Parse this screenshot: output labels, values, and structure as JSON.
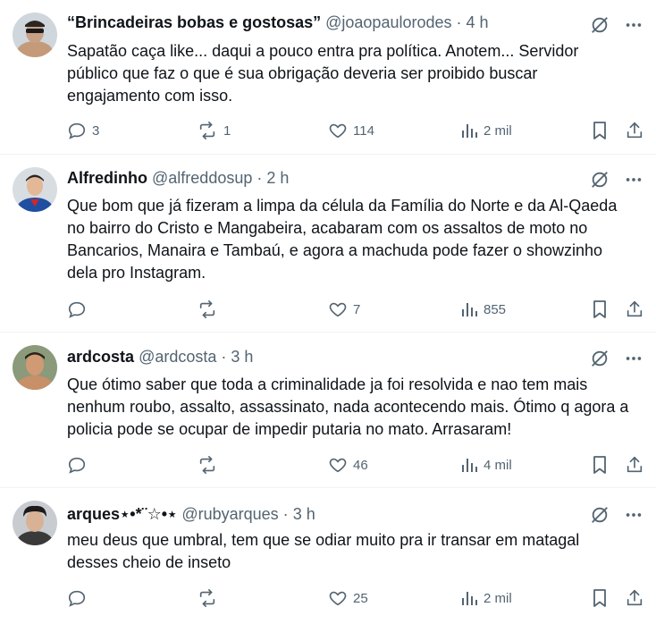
{
  "tweets": [
    {
      "name": "“Brincadeiras bobas e gostosas”",
      "handle": "@joaopaulorodes",
      "sep": "·",
      "time": "4 h",
      "text": [
        "Sapatão caça like... daqui a pouco entra pra política. Anotem... Servidor",
        "público que faz o que é sua obrigação deveria ser proibido buscar",
        "engajamento com isso."
      ],
      "replies": "3",
      "reposts": "1",
      "likes": "114",
      "views": "2 mil"
    },
    {
      "name": "Alfredinho",
      "handle": "@alfreddosup",
      "sep": "·",
      "time": "2 h",
      "text": [
        "Que bom que já fizeram a limpa da célula da Família do Norte e da Al-Qaeda",
        "no bairro do Cristo e Mangabeira, acabaram com os assaltos de moto no",
        "Bancarios, Manaira e Tambaú, e agora a machuda pode fazer o showzinho",
        "dela pro Instagram."
      ],
      "replies": "",
      "reposts": "",
      "likes": "7",
      "views": "855"
    },
    {
      "name": "ardcosta",
      "handle": "@ardcosta",
      "sep": "·",
      "time": "3 h",
      "text": [
        "Que ótimo saber que toda a criminalidade ja foi resolvida e nao tem mais",
        "nenhum roubo, assalto, assassinato, nada acontecendo mais. Ótimo q agora a",
        "policia pode se ocupar de impedir putaria no mato. Arrasaram!"
      ],
      "replies": "",
      "reposts": "",
      "likes": "46",
      "views": "4 mil"
    },
    {
      "name": "arques⋆•*¨☆•⋆",
      "handle": "@rubyarques",
      "sep": "·",
      "time": "3 h",
      "text": [
        "meu deus que umbral, tem que se odiar muito pra ir transar em matagal",
        "desses cheio de inseto"
      ],
      "replies": "",
      "reposts": "",
      "likes": "25",
      "views": "2 mil"
    }
  ],
  "colors": {
    "text": "#0f1419",
    "muted": "#536471",
    "divider": "#eff3f4"
  },
  "icons": [
    "grok-icon",
    "more-icon",
    "reply-icon",
    "repost-icon",
    "like-icon",
    "views-icon",
    "bookmark-icon",
    "share-icon"
  ]
}
